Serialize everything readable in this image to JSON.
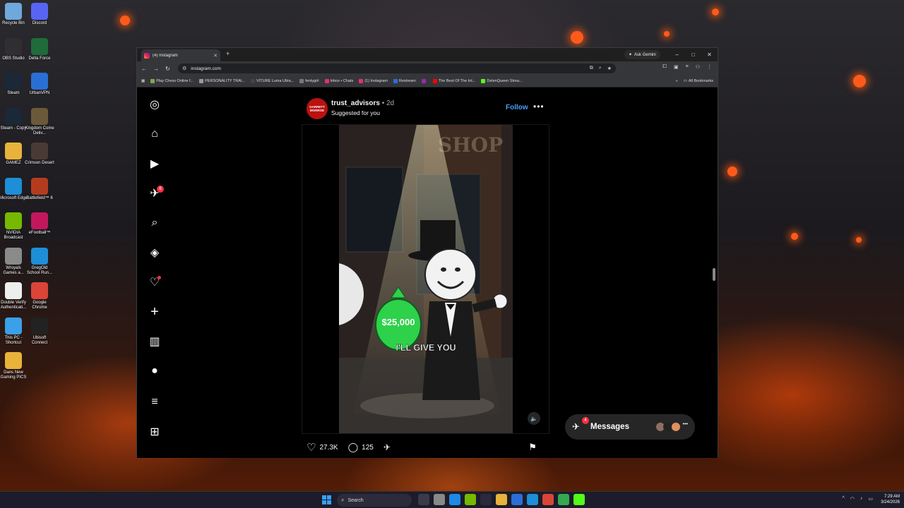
{
  "desktop": {
    "icons": [
      {
        "label": "Recycle Bin",
        "color": "#6fa8dc"
      },
      {
        "label": "Discord",
        "color": "#5865f2"
      },
      {
        "label": "OBS Studio",
        "color": "#302e31"
      },
      {
        "label": "Delta Force",
        "color": "#1f6b3a"
      },
      {
        "label": "Steam",
        "color": "#1b2838"
      },
      {
        "label": "UrbanVPN",
        "color": "#2a6fd6"
      },
      {
        "label": "Steam - Copy",
        "color": "#1b2838"
      },
      {
        "label": "Kingdom Come Deliv...",
        "color": "#6b5a3a"
      },
      {
        "label": "GAMEZ",
        "color": "#e8b33a"
      },
      {
        "label": "Crimson Desert",
        "color": "#4a3a34"
      },
      {
        "label": "Microsoft Edge",
        "color": "#1e8ed6"
      },
      {
        "label": "Battlefield™ 6",
        "color": "#b53b1e"
      },
      {
        "label": "NVIDIA Broadcast",
        "color": "#76b900"
      },
      {
        "label": "eFootball™",
        "color": "#c2185b"
      },
      {
        "label": "Wroyals Games a...",
        "color": "#8a8a8a"
      },
      {
        "label": "GregOld School Run...",
        "color": "#1e8ed6"
      },
      {
        "label": "Double Verify Authenticati...",
        "color": "#eeeeee"
      },
      {
        "label": "Google Chrome",
        "color": "#db4437"
      },
      {
        "label": "This PC - Shortcut",
        "color": "#3aa0e8"
      },
      {
        "label": "Ubisoft Connect",
        "color": "#222222"
      },
      {
        "label": "Dans New Gaming PICS",
        "color": "#e8b33a"
      }
    ]
  },
  "browser": {
    "tab_title": "(4) Instagram",
    "tab_close": "✕",
    "new_tab": "+",
    "ask_gemini": "Ask Gemini",
    "url": "instagram.com",
    "window_controls": {
      "minimize": "–",
      "maximize": "□",
      "close": "✕"
    },
    "bookmarks": [
      {
        "label": "Play Chess Online f...",
        "color": "#7fa650"
      },
      {
        "label": "PERSONALITY TRAI...",
        "color": "#999999"
      },
      {
        "label": "VITURE Luma Ultra...",
        "color": "#444444"
      },
      {
        "label": "fentygirl",
        "color": "#777777"
      },
      {
        "label": "Inbox • Chats",
        "color": "#e1306c"
      },
      {
        "label": "(1) Instagram",
        "color": "#e1306c"
      },
      {
        "label": "Restream",
        "color": "#2d6cdf"
      },
      {
        "label": "",
        "color": "#9c27b0"
      },
      {
        "label": "The Best Of The Int...",
        "color": "#ff0000"
      },
      {
        "label": "DelenQueen Strea...",
        "color": "#53fc18"
      }
    ],
    "all_bookmarks": "All Bookmarks",
    "more_bookmarks": "»"
  },
  "instagram": {
    "sidebar": [
      {
        "name": "instagram-logo-icon",
        "glyph": "◎"
      },
      {
        "name": "home-icon",
        "glyph": "⌂"
      },
      {
        "name": "reels-icon",
        "glyph": "▶"
      },
      {
        "name": "messages-nav-icon",
        "glyph": "✈",
        "badge": "6"
      },
      {
        "name": "search-icon",
        "glyph": "⌕"
      },
      {
        "name": "explore-icon",
        "glyph": "◈"
      },
      {
        "name": "notifications-heart-icon",
        "glyph": "♡",
        "dot": true
      },
      {
        "name": "create-plus-icon",
        "glyph": "+"
      },
      {
        "name": "dashboard-icon",
        "glyph": "▥"
      },
      {
        "name": "profile-avatar-icon",
        "glyph": "●"
      },
      {
        "name": "menu-icon",
        "glyph": "≡"
      },
      {
        "name": "also-from-meta-icon",
        "glyph": "⊞"
      }
    ],
    "post": {
      "avatar_text": "GARRETT MONROE",
      "username": "trust_advisors",
      "age": " • 2d",
      "subtitle": "Suggested for you",
      "follow_label": "Follow",
      "more_label": "•••",
      "video": {
        "sign_text": "SHOP",
        "bag_value": "$25,000",
        "caption": "I'LL GIVE YOU",
        "mute_icon": "🔈"
      },
      "likes": "27.3K",
      "comments": "125"
    },
    "messages": {
      "label": "Messages",
      "badge": "4",
      "avatars": [
        "#8d6e63",
        "#222222",
        "#e09060"
      ],
      "more": "•••"
    }
  },
  "taskbar": {
    "search_label": "Search",
    "apps": [
      "#3a3a4a",
      "#888888",
      "#1e88e5",
      "#76b900",
      "#2a2a3a",
      "#e8b33a",
      "#2b6fd6",
      "#1e8ed6",
      "#db4437",
      "#34a853",
      "#53fc18"
    ],
    "time": "7:29 AM",
    "date": "3/24/2026"
  }
}
